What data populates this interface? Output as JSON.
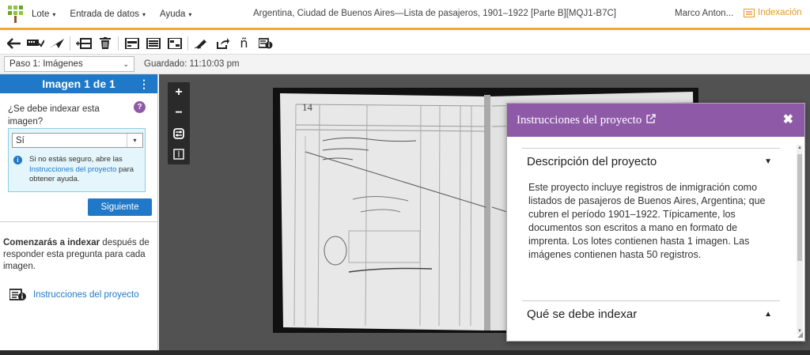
{
  "topbar": {
    "menu": [
      {
        "label": "Lote",
        "caret": "▾"
      },
      {
        "label": "Entrada de datos",
        "caret": "▾"
      },
      {
        "label": "Ayuda",
        "caret": "▾"
      }
    ],
    "doc_title": "Argentina, Ciudad de Buenos Aires—Lista de pasajeros, 1901–1922 [Parte B][MQJ1-B7C]",
    "user_name": "Marco Anton...",
    "index_link": "Indexación",
    "accent_color": "#f0a830"
  },
  "toolbar": {
    "icons": [
      "back-arrow-icon",
      "keyboard-check-icon",
      "send-icon",
      "add-record-icon",
      "trash-icon",
      "field-list-icon",
      "field-split-icon",
      "field-merge-icon",
      "pen-icon",
      "share-icon",
      "n-tilde-icon",
      "instructions-icon"
    ]
  },
  "stepbar": {
    "step": "Paso 1: Imágenes",
    "saved": "Guardado: 11:10:03 pm"
  },
  "leftpanel": {
    "header": "Imagen 1 de 1",
    "question": "¿Se debe indexar esta imagen?",
    "answer": "Sí",
    "info_prefix": "Si no estás seguro, abre las",
    "info_link": "Instrucciones del proyecto",
    "info_suffix": "para obtener ayuda.",
    "next_button": "Siguiente",
    "begin_bold": "Comenzarás a indexar",
    "begin_rest": "después de responder esta pregunta para cada imagen.",
    "project_instructions": "Instrucciones del proyecto",
    "header_color": "#1f78c8"
  },
  "modal": {
    "title": "Instrucciones del proyecto",
    "header_color": "#8e5aa7",
    "sections": [
      {
        "title": "Descripción del proyecto",
        "arrow": "▼",
        "text": "Este proyecto incluye registros de inmigración como listados de pasajeros de Buenos Aires, Argentina; que cubren el período 1901–1922. Típicamente, los documentos son escritos a mano en formato de imprenta. Los lotes contienen hasta 1 imagen. Las imágenes contienen hasta 50 registros."
      },
      {
        "title": "Qué se debe indexar",
        "arrow": "▲"
      }
    ]
  }
}
